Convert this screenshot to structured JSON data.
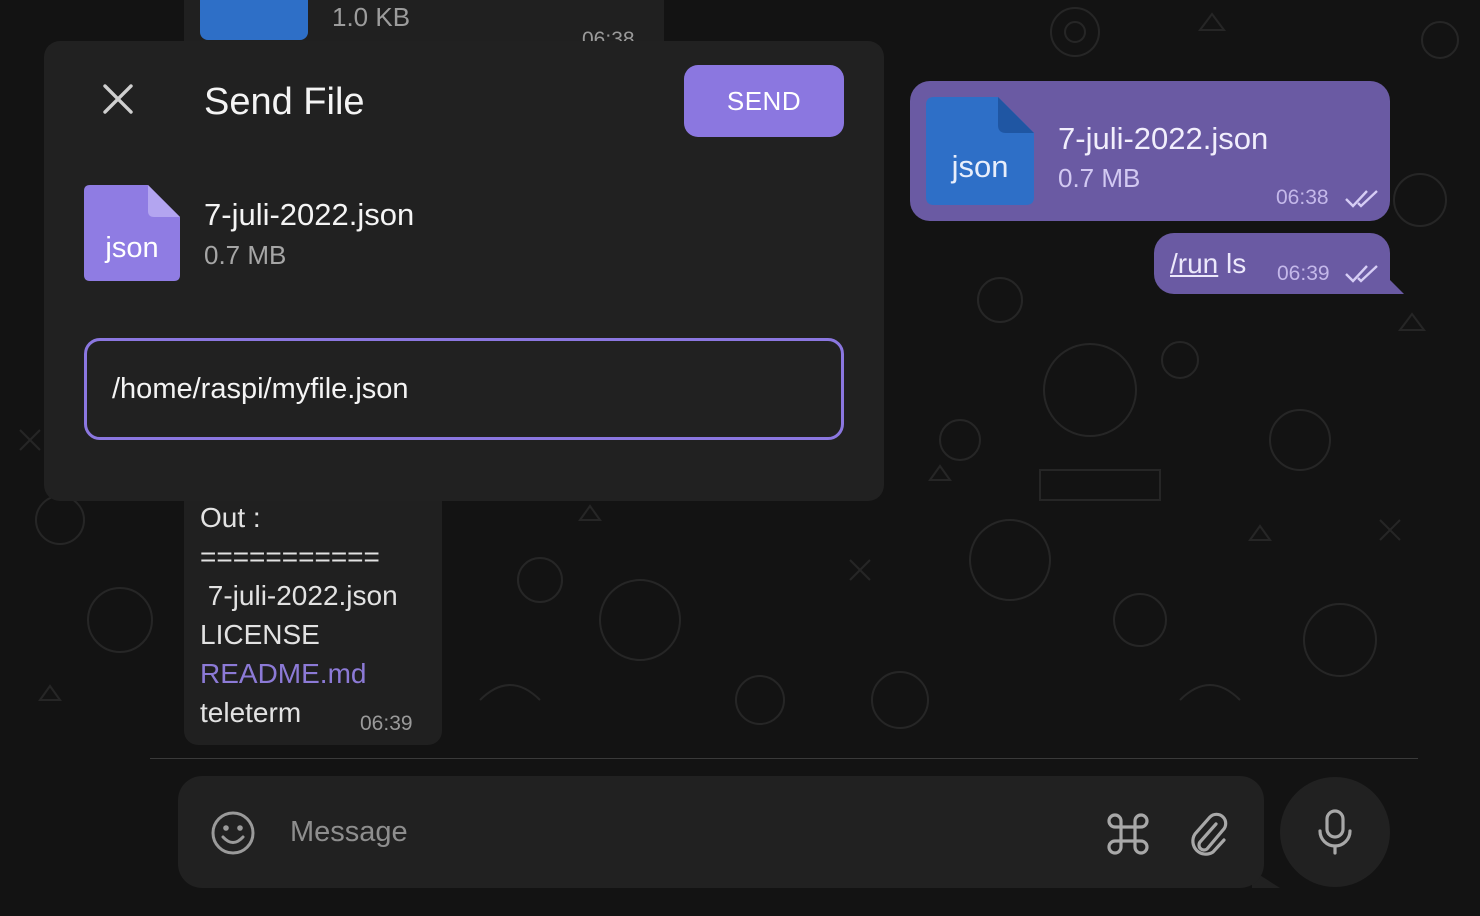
{
  "colors": {
    "accent": "#8b77e0",
    "outgoing_bubble": "#6a5aa3",
    "incoming_bubble": "#202020",
    "file_icon_blue": "#2e6fc7",
    "file_icon_purple": "#8f7ce3"
  },
  "chat": {
    "top_file_message": {
      "size": "1.0 KB",
      "time": "06:38"
    },
    "outgoing_file_message": {
      "icon_label": "json",
      "file_name": "7-juli-2022.json",
      "size": "0.7 MB",
      "time": "06:38",
      "status_icon": "double-check-icon"
    },
    "outgoing_command": {
      "command": "/run",
      "argument": " ls",
      "time": "06:39",
      "status_icon": "double-check-icon"
    },
    "output_message": {
      "lines": [
        "Out :",
        "===========",
        " 7-juli-2022.json",
        "LICENSE",
        "README.md",
        "teleterm"
      ],
      "time": "06:39"
    }
  },
  "composer": {
    "placeholder": "Message",
    "emoji_icon": "smiley-icon",
    "command_icon": "command-icon",
    "attach_icon": "paperclip-icon",
    "mic_icon": "microphone-icon"
  },
  "send_file_dialog": {
    "title": "Send File",
    "close_icon": "close-icon",
    "send_label": "SEND",
    "file": {
      "icon_label": "json",
      "name": "7-juli-2022.json",
      "size": "0.7 MB"
    },
    "caption_value": "/home/raspi/myfile.json"
  }
}
